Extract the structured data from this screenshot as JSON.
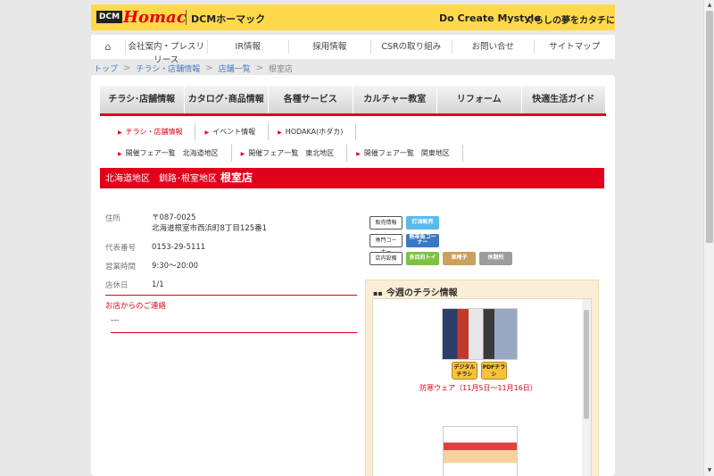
{
  "header": {
    "logo_dcm": "DCM",
    "logo_homac": "Homac",
    "logo_hormark": "DCMホーマック",
    "tagline_en": "Do Create Mystyle",
    "tagline_ja": "くらしの夢をカタチに"
  },
  "topnav": {
    "items": [
      "会社案内・プレスリリース",
      "IR情報",
      "採用情報",
      "CSRの取り組み",
      "お問い合せ",
      "サイトマップ"
    ]
  },
  "breadcrumb": {
    "items": [
      "トップ",
      "チラシ・店舗情報",
      "店舗一覧"
    ],
    "current": "根室店"
  },
  "category_nav": {
    "items": [
      "チラシ･店舗情報",
      "カタログ･商品情報",
      "各種サービス",
      "カルチャー教室",
      "リフォーム",
      "快適生活ガイド"
    ]
  },
  "subnav": {
    "row1": [
      "チラシ・店舗情報",
      "イベント情報",
      "HODAKA(ホダカ)"
    ],
    "row2": [
      "開催フェア一覧　北海道地区",
      "開催フェア一覧　東北地区",
      "開催フェア一覧　関東地区"
    ]
  },
  "store": {
    "region": "北海道地区　釧路･根室地区",
    "name": "根室店",
    "address_label": "住所",
    "postal": "〒087-0025",
    "address": "北海道根室市西浜町8丁目125番1",
    "phone_label": "代表番号",
    "phone": "0153-29-5111",
    "hours_label": "営業時間",
    "hours": "9:30～20:00",
    "closed_label": "店休日",
    "closed": "1/1",
    "contact_title": "お店からのご連絡",
    "contact_body": "---"
  },
  "badges": {
    "sales_label": "販売情報",
    "sales": [
      "灯油販売"
    ],
    "corner_label": "専門コーナー",
    "corner": [
      "熱帯魚コーナー"
    ],
    "facility_label": "店内設備",
    "facility": [
      "多目的トイレ",
      "車椅子",
      "休憩所"
    ],
    "colors": {
      "blue": "#5ab9ea",
      "darkblue": "#3b78c3",
      "green": "#7cc243",
      "brown": "#c9a15c",
      "gray": "#9c9c9c"
    }
  },
  "flyers": {
    "title": "今週のチラシ情報",
    "digital_label": "デジタルチラシ",
    "pdf_label": "PDFチラシ",
    "caption": "防寒ウェア（11月5日～11月16日）"
  },
  "colors": {
    "accent": "#e00019",
    "banner": "#ffd94a"
  }
}
